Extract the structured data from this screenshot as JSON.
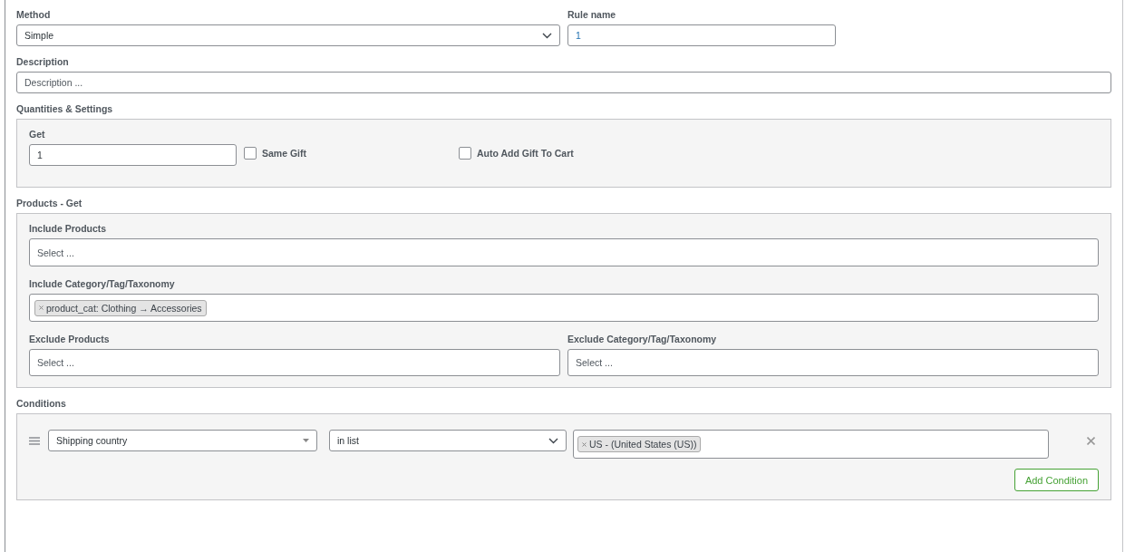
{
  "method": {
    "label": "Method",
    "value": "Simple"
  },
  "rule_name": {
    "label": "Rule name",
    "value": "1"
  },
  "description": {
    "label": "Description",
    "placeholder": "Description ..."
  },
  "quantities": {
    "title": "Quantities & Settings",
    "get": {
      "label": "Get",
      "value": "1"
    },
    "checkboxes": [
      {
        "label": "Same Gift",
        "checked": false
      },
      {
        "label": "Auto Add Gift To Cart",
        "checked": false
      }
    ]
  },
  "products": {
    "title": "Products - Get",
    "include_products": {
      "label": "Include Products",
      "placeholder": "Select ..."
    },
    "include_taxonomy": {
      "label": "Include Category/Tag/Taxonomy",
      "tags": [
        "product_cat: Clothing → Accessories"
      ]
    },
    "exclude_products": {
      "label": "Exclude Products",
      "placeholder": "Select ..."
    },
    "exclude_taxonomy": {
      "label": "Exclude Category/Tag/Taxonomy",
      "placeholder": "Select ..."
    }
  },
  "conditions": {
    "title": "Conditions",
    "rows": [
      {
        "field": "Shipping country",
        "operator": "in list",
        "tags": [
          "US - (United States (US))"
        ]
      }
    ],
    "add_button": "Add Condition"
  }
}
